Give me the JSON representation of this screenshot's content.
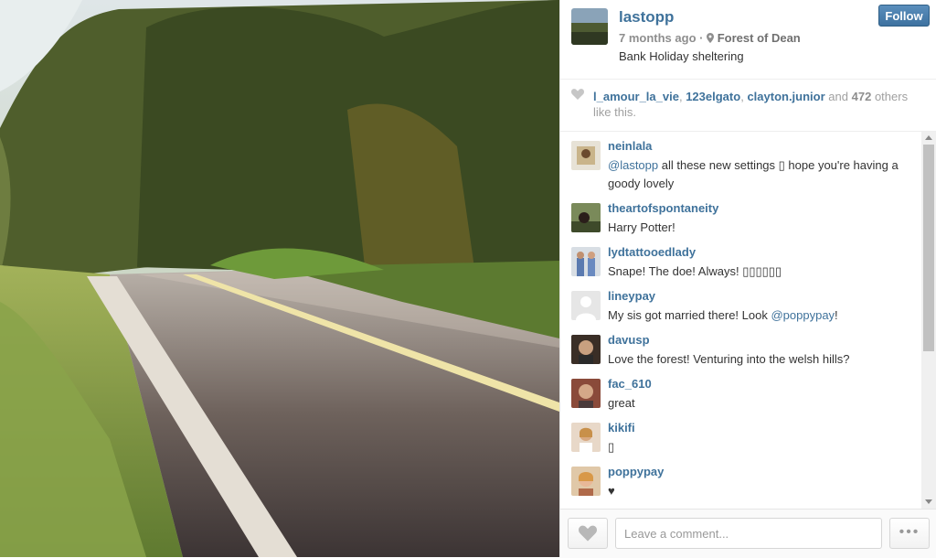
{
  "photo": {
    "alt": ""
  },
  "header": {
    "username": "lastopp",
    "time_ago": "7 months ago",
    "separator": "·",
    "location": "Forest of Dean",
    "caption": "Bank Holiday sheltering",
    "follow_label": "Follow"
  },
  "likes": {
    "users": [
      "l_amour_la_vie",
      "123elgato",
      "clayton.junior"
    ],
    "comma": ",",
    "and_text": "and",
    "count": "472",
    "suffix": "others like this."
  },
  "comments": [
    {
      "user": "neinlala",
      "mention": "@lastopp",
      "text": " all these new settings ▯ hope you're having a goody lovely"
    },
    {
      "user": "theartofspontaneity",
      "mention": "",
      "text": "Harry Potter!"
    },
    {
      "user": "lydtattooedlady",
      "mention": "",
      "text": "Snape! The doe! Always! ▯▯▯▯▯▯"
    },
    {
      "user": "lineypay",
      "mention": "",
      "text": "My sis got married there! Look ",
      "mention_after": "@poppypay",
      "text_after": "!"
    },
    {
      "user": "davusp",
      "mention": "",
      "text": "Love the forest! Venturing into the welsh hills?"
    },
    {
      "user": "fac_610",
      "mention": "",
      "text": "great"
    },
    {
      "user": "kikifi",
      "mention": "",
      "text": "▯"
    },
    {
      "user": "poppypay",
      "mention": "",
      "text": "♥"
    }
  ],
  "footer": {
    "comment_placeholder": "Leave a comment...",
    "more_label": "•••"
  },
  "colors": {
    "link": "#3f729b",
    "follow_bg": "#4a7eab",
    "muted": "#8e8e8e"
  },
  "icons": {
    "location": "location-pin-icon",
    "like": "heart-icon",
    "more": "more-options-icon"
  }
}
